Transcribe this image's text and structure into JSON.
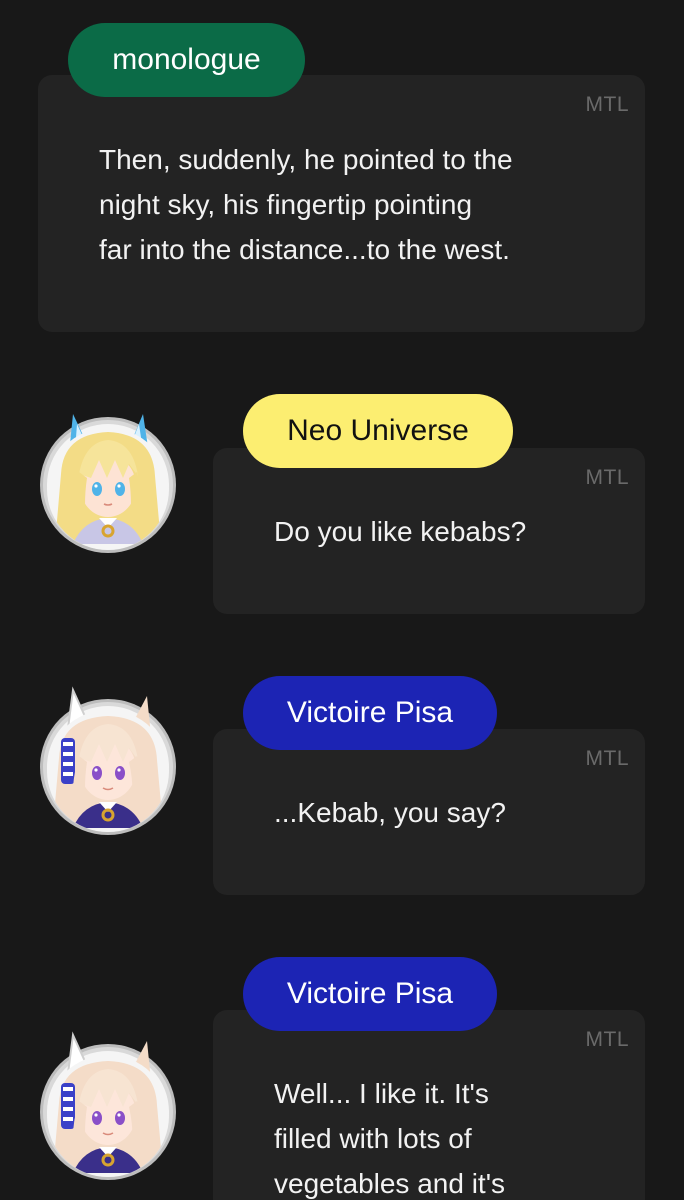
{
  "colors": {
    "background": "#181818",
    "card": "#232323",
    "monologue_pill": "#0b6b47",
    "neo_universe_pill": "#fcee71",
    "victoire_pisa_pill": "#1c24b4"
  },
  "messages": [
    {
      "speaker": "monologue",
      "tag": "MTL",
      "text_lines": [
        "Then, suddenly, he pointed to the",
        "night sky, his fingertip pointing",
        "far into the distance...to the west."
      ]
    },
    {
      "speaker": "Neo Universe",
      "avatar_icon": "neo-universe-avatar-icon",
      "tag": "MTL",
      "text_lines": [
        "Do you like kebabs?"
      ]
    },
    {
      "speaker": "Victoire Pisa",
      "avatar_icon": "victoire-pisa-avatar-icon",
      "tag": "MTL",
      "text_lines": [
        "...Kebab, you say?"
      ]
    },
    {
      "speaker": "Victoire Pisa",
      "avatar_icon": "victoire-pisa-avatar-icon",
      "tag": "MTL",
      "text_lines": [
        "Well... I like it. It's",
        "filled with lots of",
        "vegetables and it's"
      ]
    }
  ]
}
